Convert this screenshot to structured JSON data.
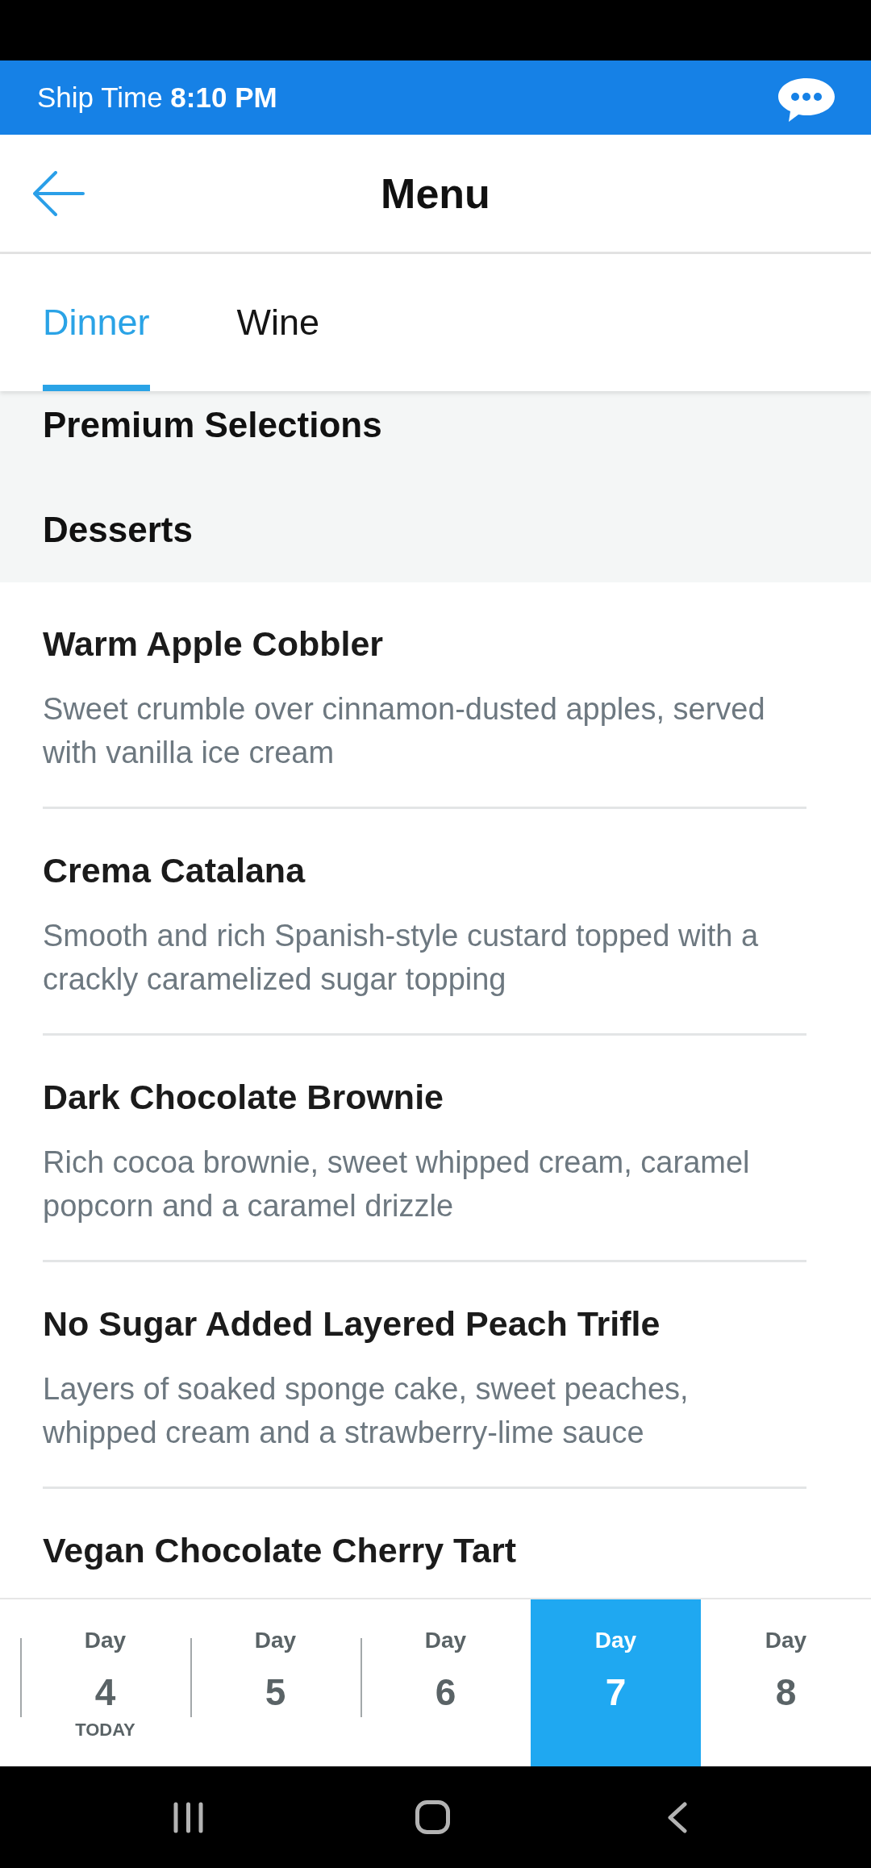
{
  "ship_bar": {
    "text": "Ship Time **8:10 PM**"
  },
  "header": {
    "title": "Menu"
  },
  "tabs": [
    {
      "label": "Dinner",
      "selected": true
    },
    {
      "label": "Wine",
      "selected": false
    }
  ],
  "sections": [
    {
      "title": "Premium Selections"
    },
    {
      "title": "Desserts"
    }
  ],
  "items": [
    {
      "name": "Warm Apple Cobbler",
      "description": "Sweet crumble over cinnamon-dusted apples, served with vanilla ice cream"
    },
    {
      "name": "Crema Catalana",
      "description": "Smooth and rich Spanish-style custard topped with a crackly caramelized sugar topping"
    },
    {
      "name": "Dark Chocolate Brownie",
      "description": "Rich cocoa brownie, sweet whipped cream, caramel popcorn and a caramel drizzle"
    },
    {
      "name": "No Sugar Added Layered Peach Trifle",
      "description": "Layers of soaked sponge cake, sweet peaches, whipped cream and a strawberry-lime sauce"
    },
    {
      "name": "Vegan Chocolate Cherry Tart"
    }
  ],
  "days": [
    {
      "label": "Day",
      "number": "4",
      "note": "TODAY",
      "selected": false
    },
    {
      "label": "Day",
      "number": "5",
      "selected": false
    },
    {
      "label": "Day",
      "number": "6",
      "selected": false
    },
    {
      "label": "Day",
      "number": "7",
      "selected": true
    },
    {
      "label": "Day",
      "number": "8",
      "selected": false
    }
  ]
}
